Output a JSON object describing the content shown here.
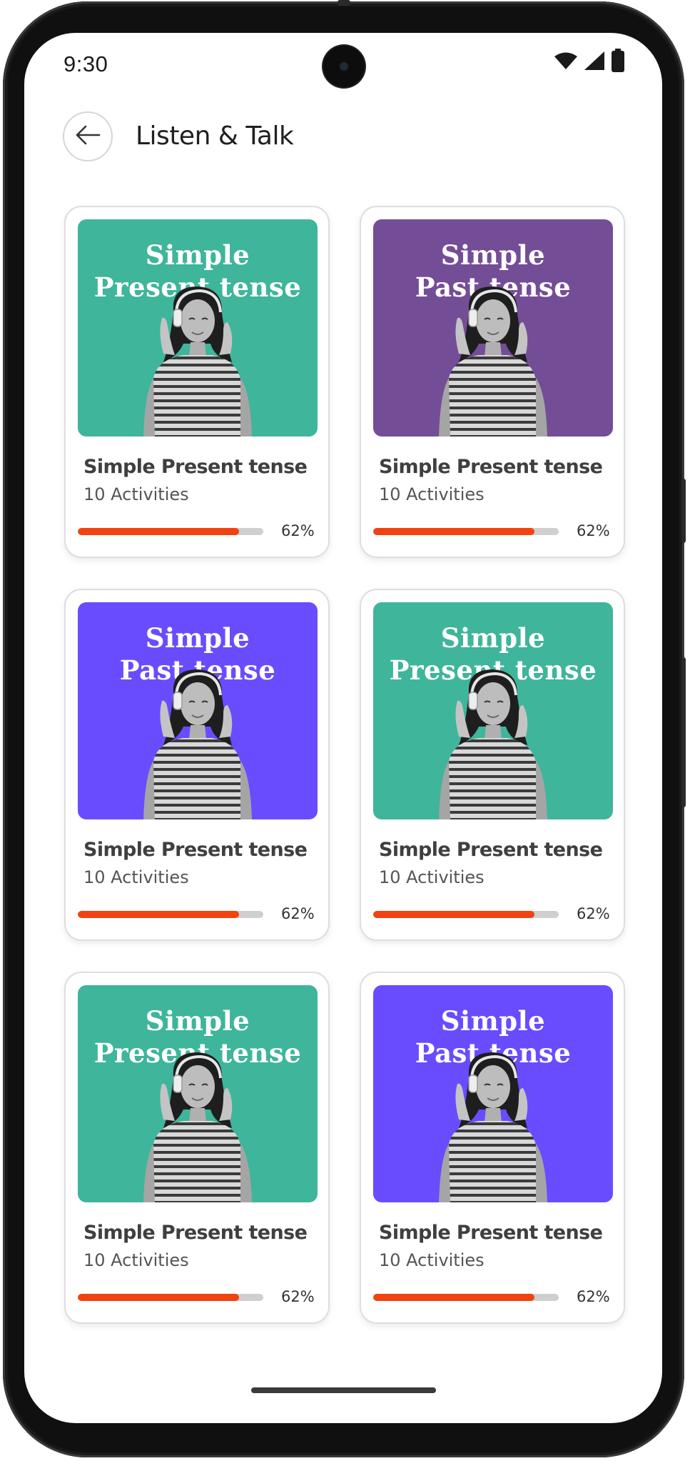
{
  "status_bar": {
    "time": "9:30"
  },
  "header": {
    "title": "Listen & Talk",
    "back_icon": "arrow-left-icon"
  },
  "colors": {
    "teal": "#3fb59b",
    "plum": "#744d97",
    "violet": "#6a4cff",
    "progress": "#f2420f",
    "track": "#cfcfcf"
  },
  "cards": [
    {
      "thumb_line1": "Simple",
      "thumb_line2": "Present tense",
      "bg": "#3fb59b",
      "title": "Simple Present tense",
      "subtitle": "10 Activities",
      "progress": 0.87,
      "progress_label": "62%"
    },
    {
      "thumb_line1": "Simple",
      "thumb_line2": "Past tense",
      "bg": "#744d97",
      "title": "Simple Present tense",
      "subtitle": "10 Activities",
      "progress": 0.87,
      "progress_label": "62%"
    },
    {
      "thumb_line1": "Simple",
      "thumb_line2": "Past tense",
      "bg": "#6a4cff",
      "title": "Simple Present tense",
      "subtitle": "10 Activities",
      "progress": 0.87,
      "progress_label": "62%"
    },
    {
      "thumb_line1": "Simple",
      "thumb_line2": "Present tense",
      "bg": "#3fb59b",
      "title": "Simple Present tense",
      "subtitle": "10 Activities",
      "progress": 0.87,
      "progress_label": "62%"
    },
    {
      "thumb_line1": "Simple",
      "thumb_line2": "Present tense",
      "bg": "#3fb59b",
      "title": "Simple Present tense",
      "subtitle": "10 Activities",
      "progress": 0.87,
      "progress_label": "62%"
    },
    {
      "thumb_line1": "Simple",
      "thumb_line2": "Past tense",
      "bg": "#6a4cff",
      "title": "Simple Present tense",
      "subtitle": "10 Activities",
      "progress": 0.87,
      "progress_label": "62%"
    }
  ]
}
